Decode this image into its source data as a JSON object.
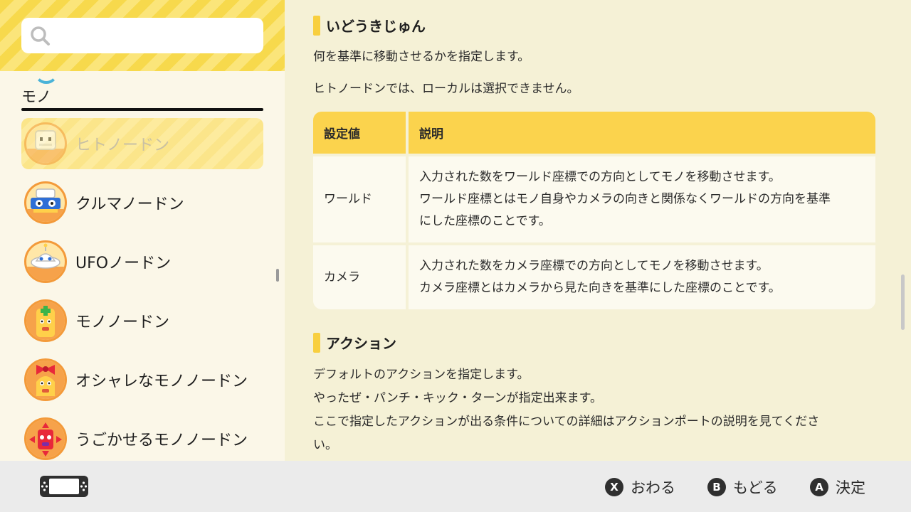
{
  "search": {
    "placeholder": ""
  },
  "sidebar": {
    "category": "モノ",
    "items": [
      {
        "label": "ヒトノードン",
        "selected": true,
        "icon": "robot-face-icon"
      },
      {
        "label": "クルマノードン",
        "selected": false,
        "icon": "car-face-icon"
      },
      {
        "label": "UFOノードン",
        "selected": false,
        "icon": "ufo-face-icon"
      },
      {
        "label": "モノノードン",
        "selected": false,
        "icon": "object-face-icon"
      },
      {
        "label": "オシャレなモノノードン",
        "selected": false,
        "icon": "fancy-object-face-icon"
      },
      {
        "label": "うごかせるモノノードン",
        "selected": false,
        "icon": "movable-object-face-icon"
      }
    ]
  },
  "main": {
    "section1": {
      "title": "いどうきじゅん",
      "paragraphs": [
        "何を基準に移動させるかを指定します。",
        "ヒトノードンでは、ローカルは選択できません。"
      ]
    },
    "table": {
      "headers": [
        "設定値",
        "説明"
      ],
      "rows": [
        {
          "value": "ワールド",
          "lines": [
            "入力された数をワールド座標での方向としてモノを移動させます。",
            "ワールド座標とはモノ自身やカメラの向きと関係なくワールドの方向を基準",
            "にした座標のことです。"
          ]
        },
        {
          "value": "カメラ",
          "lines": [
            "入力された数をカメラ座標での方向としてモノを移動させます。",
            "カメラ座標とはカメラから見た向きを基準にした座標のことです。"
          ]
        }
      ]
    },
    "section2": {
      "title": "アクション",
      "paragraphs": [
        "デフォルトのアクションを指定します。",
        "やったぜ・パンチ・キック・ターンが指定出来ます。",
        "ここで指定したアクションが出る条件についての詳細はアクションポートの説明を見てくださ",
        "い。"
      ]
    }
  },
  "footer": {
    "hints": [
      {
        "button": "X",
        "label": "おわる"
      },
      {
        "button": "B",
        "label": "もどる"
      },
      {
        "button": "A",
        "label": "決定"
      }
    ]
  },
  "colors": {
    "accent_yellow": "#fbd34d",
    "background": "#f5f1d6",
    "footer": "#ebebeb"
  }
}
